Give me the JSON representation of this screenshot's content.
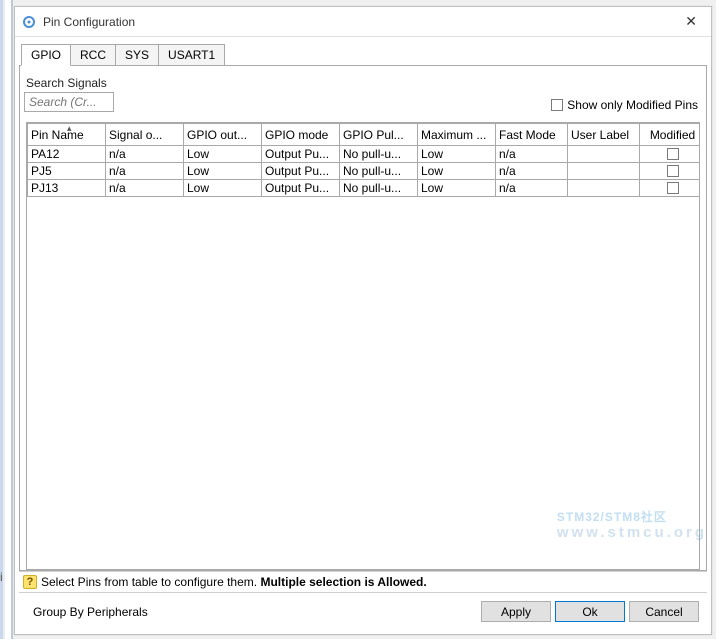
{
  "titlebar": {
    "icon": "gear-icon",
    "title": "Pin Configuration",
    "close": "✕"
  },
  "tabs": [
    "GPIO",
    "RCC",
    "SYS",
    "USART1"
  ],
  "active_tab": 0,
  "search": {
    "label": "Search Signals",
    "placeholder": "Search (Cr..."
  },
  "show_modified": {
    "checked": false,
    "label": "Show only Modified Pins"
  },
  "columns": [
    "Pin Name",
    "Signal o...",
    "GPIO out...",
    "GPIO mode",
    "GPIO Pul...",
    "Maximum ...",
    "Fast Mode",
    "User Label",
    "Modified"
  ],
  "rows": [
    {
      "pin": "PA12",
      "signal": "n/a",
      "out": "Low",
      "mode": "Output Pu...",
      "pull": "No pull-u...",
      "max": "Low",
      "fast": "n/a",
      "label": "",
      "modified": false
    },
    {
      "pin": "PJ5",
      "signal": "n/a",
      "out": "Low",
      "mode": "Output Pu...",
      "pull": "No pull-u...",
      "max": "Low",
      "fast": "n/a",
      "label": "",
      "modified": false
    },
    {
      "pin": "PJ13",
      "signal": "n/a",
      "out": "Low",
      "mode": "Output Pu...",
      "pull": "No pull-u...",
      "max": "Low",
      "fast": "n/a",
      "label": "",
      "modified": false
    }
  ],
  "hint": {
    "text_a": "Select Pins from table to configure them. ",
    "text_b": "Multiple selection is Allowed."
  },
  "footer": {
    "group_label": "Group By Peripherals",
    "group_checked": false,
    "buttons": {
      "apply": "Apply",
      "ok": "Ok",
      "cancel": "Cancel"
    }
  },
  "watermark": {
    "line1": "STM32/STM8社区",
    "line2": "www.stmcu.org"
  }
}
